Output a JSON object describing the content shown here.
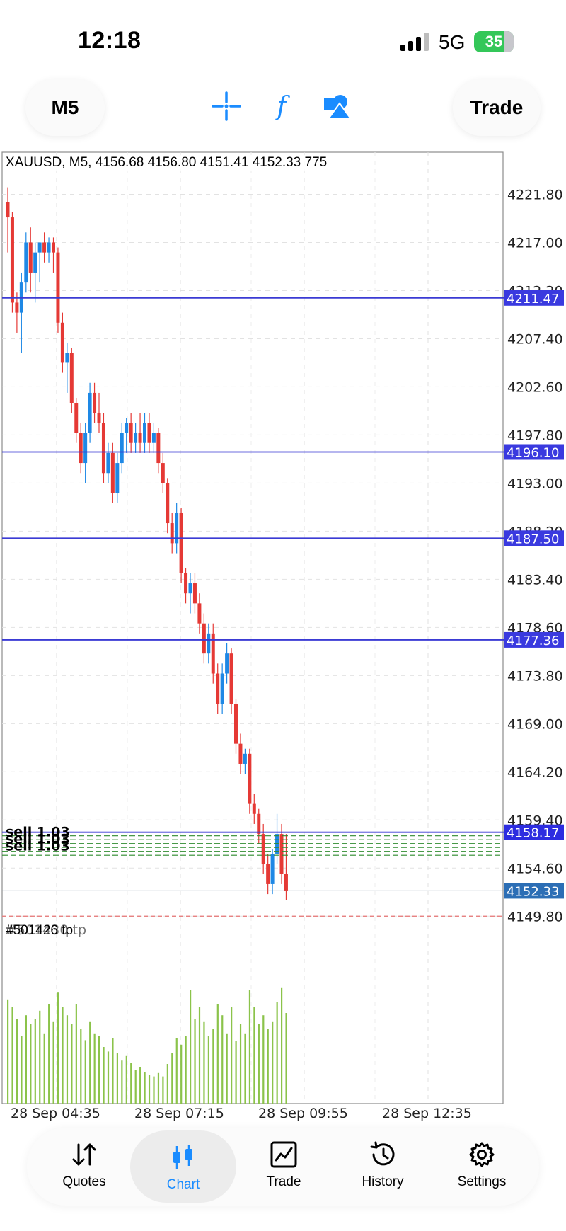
{
  "status_bar": {
    "time": "12:18",
    "network": "5G",
    "battery": "35"
  },
  "toolbar": {
    "timeframe_label": "M5",
    "trade_label": "Trade",
    "icons": [
      "crosshair-icon",
      "indicator-f-icon",
      "objects-shapes-icon"
    ]
  },
  "chart": {
    "info": "XAUUSD, M5, 4156.68 4156.80 4151.41 4152.33 775",
    "order_label": "#501426 tp",
    "order_label_overlap": "#501430 tp",
    "position_labels": [
      "sell 1.03",
      "sell 1.03",
      "sell 1.03"
    ],
    "colors": {
      "up": "#1e88e5",
      "down": "#e53935",
      "hline": "#3b3bd4",
      "volume": "#8bc34a",
      "bid": "#2c6eb5",
      "tp": "#e57373"
    }
  },
  "chart_data": {
    "type": "candlestick",
    "symbol": "XAUUSD",
    "timeframe": "M5",
    "ylim": [
      4146.5,
      4226.0
    ],
    "y_ticks": [
      "4221.80",
      "4217.00",
      "4212.20",
      "4207.40",
      "4202.60",
      "4197.80",
      "4193.00",
      "4188.20",
      "4183.40",
      "4178.60",
      "4173.80",
      "4169.00",
      "4164.20",
      "4159.40",
      "4154.60",
      "4149.80"
    ],
    "x_ticks": [
      "28 Sep 04:35",
      "28 Sep 07:15",
      "28 Sep 09:55",
      "28 Sep 12:35"
    ],
    "price_lines": [
      "4211.47",
      "4196.10",
      "4187.50",
      "4177.36"
    ],
    "entry_line": "4158.17",
    "bid_line": "4152.33",
    "tp_line": "4149.80",
    "candles": [
      [
        4221,
        4222.5,
        4216,
        4219.5
      ],
      [
        4219.5,
        4220,
        4210,
        4211
      ],
      [
        4211,
        4212,
        4208,
        4210
      ],
      [
        4210,
        4214,
        4206,
        4213
      ],
      [
        4213,
        4218,
        4212,
        4217
      ],
      [
        4217,
        4218.5,
        4212,
        4214
      ],
      [
        4214,
        4217,
        4211,
        4216
      ],
      [
        4216,
        4217,
        4213,
        4217
      ],
      [
        4217,
        4218,
        4215,
        4216
      ],
      [
        4216,
        4217.5,
        4215,
        4217
      ],
      [
        4217,
        4217.5,
        4214,
        4216
      ],
      [
        4216,
        4216.5,
        4208,
        4209
      ],
      [
        4209,
        4210,
        4204,
        4205
      ],
      [
        4205,
        4207,
        4202,
        4206
      ],
      [
        4206,
        4206.5,
        4200,
        4201
      ],
      [
        4201,
        4201.5,
        4197,
        4198
      ],
      [
        4198,
        4199,
        4194,
        4195
      ],
      [
        4195,
        4199,
        4193,
        4198
      ],
      [
        4198,
        4203,
        4197,
        4202
      ],
      [
        4202,
        4203,
        4199,
        4200
      ],
      [
        4200,
        4202,
        4198,
        4199
      ],
      [
        4199,
        4200,
        4193,
        4194
      ],
      [
        4194,
        4197,
        4193,
        4196
      ],
      [
        4196,
        4197,
        4191,
        4192
      ],
      [
        4192,
        4196,
        4191,
        4195
      ],
      [
        4195,
        4199,
        4194,
        4198
      ],
      [
        4198,
        4199.5,
        4196,
        4199
      ],
      [
        4199,
        4200,
        4196,
        4197
      ],
      [
        4197,
        4199,
        4196,
        4198
      ],
      [
        4198,
        4200,
        4196,
        4197
      ],
      [
        4197,
        4200,
        4196,
        4199
      ],
      [
        4199,
        4200,
        4196,
        4197
      ],
      [
        4197,
        4199,
        4196,
        4198
      ],
      [
        4198,
        4198.5,
        4194,
        4195
      ],
      [
        4195,
        4196,
        4192,
        4193
      ],
      [
        4193,
        4193.5,
        4188,
        4189
      ],
      [
        4189,
        4190,
        4186,
        4187
      ],
      [
        4187,
        4191,
        4186,
        4190
      ],
      [
        4190,
        4190.5,
        4183,
        4184
      ],
      [
        4184,
        4184.5,
        4181,
        4182
      ],
      [
        4182,
        4184,
        4180,
        4183
      ],
      [
        4183,
        4184,
        4180,
        4181
      ],
      [
        4181,
        4182,
        4178,
        4179
      ],
      [
        4179,
        4180,
        4175,
        4176
      ],
      [
        4176,
        4179,
        4175,
        4178
      ],
      [
        4178,
        4179,
        4173,
        4174
      ],
      [
        4174,
        4175,
        4170,
        4171
      ],
      [
        4171,
        4175,
        4170,
        4174
      ],
      [
        4174,
        4177,
        4173,
        4176
      ],
      [
        4176,
        4176.5,
        4170,
        4171
      ],
      [
        4171,
        4171.5,
        4166,
        4167
      ],
      [
        4167,
        4168,
        4164,
        4165
      ],
      [
        4165,
        4166.5,
        4164,
        4166
      ],
      [
        4166,
        4166.5,
        4160,
        4161
      ],
      [
        4161,
        4162,
        4159,
        4160
      ],
      [
        4160,
        4160.5,
        4157,
        4158
      ],
      [
        4158,
        4159,
        4154,
        4155
      ],
      [
        4155,
        4156,
        4152,
        4153
      ],
      [
        4153,
        4156.5,
        4152,
        4156
      ],
      [
        4156,
        4160,
        4155,
        4158
      ],
      [
        4158,
        4159,
        4153,
        4154
      ],
      [
        4154,
        4158,
        4151.4,
        4152.33
      ]
    ],
    "volumes": [
      0.92,
      0.85,
      0.75,
      0.6,
      0.78,
      0.7,
      0.75,
      0.82,
      0.62,
      0.88,
      0.72,
      0.98,
      0.85,
      0.78,
      0.7,
      0.88,
      0.66,
      0.56,
      0.72,
      0.62,
      0.6,
      0.5,
      0.46,
      0.58,
      0.45,
      0.38,
      0.42,
      0.36,
      0.3,
      0.32,
      0.28,
      0.25,
      0.24,
      0.27,
      0.24,
      0.35,
      0.45,
      0.58,
      0.52,
      0.6,
      1.0,
      0.75,
      0.85,
      0.72,
      0.6,
      0.66,
      0.88,
      0.78,
      0.62,
      0.85,
      0.55,
      0.7,
      0.62,
      1.0,
      0.85,
      0.7,
      0.78,
      0.66,
      0.72,
      0.9,
      1.02,
      0.8
    ]
  },
  "bottom_nav": {
    "items": [
      {
        "label": "Quotes",
        "icon": "quotes-arrows-icon",
        "active": false
      },
      {
        "label": "Chart",
        "icon": "candlestick-chart-icon",
        "active": true
      },
      {
        "label": "Trade",
        "icon": "trade-chart-icon",
        "active": false
      },
      {
        "label": "History",
        "icon": "history-clock-icon",
        "active": false
      },
      {
        "label": "Settings",
        "icon": "settings-gear-icon",
        "active": false
      }
    ]
  }
}
